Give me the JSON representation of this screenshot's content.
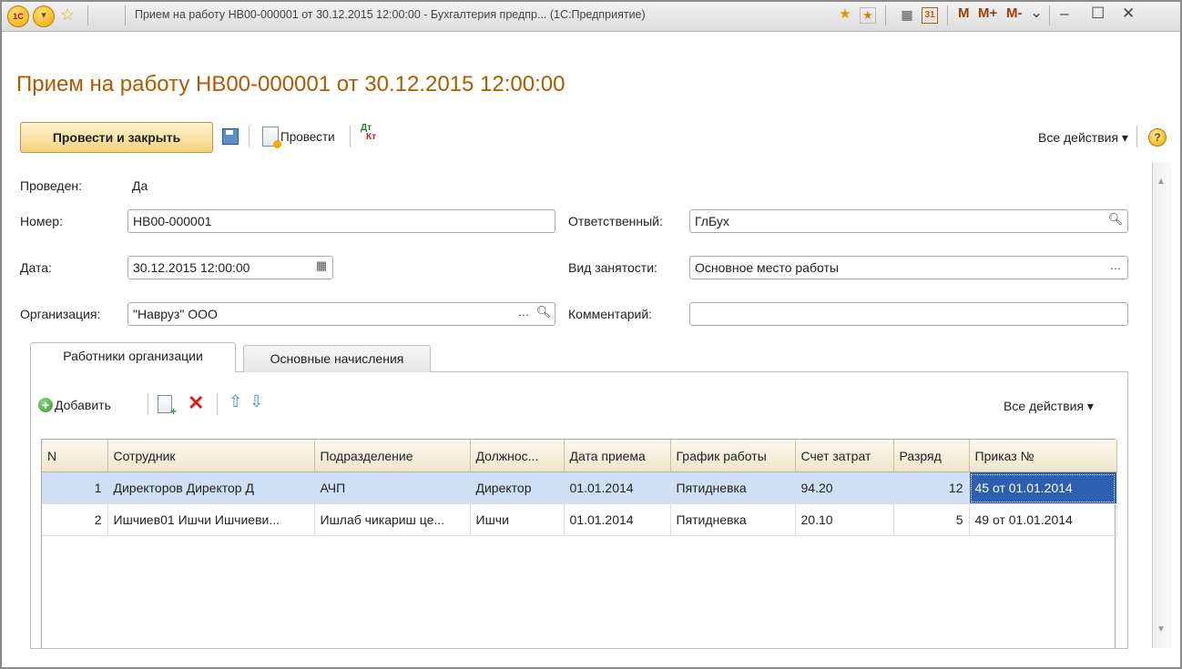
{
  "window": {
    "title": "Прием на работу НВ00-000001 от 30.12.2015 12:00:00 - Бухгалтерия предпр... (1С:Предприятие)",
    "logo_text": "1С",
    "icons": [
      "app-menu-icon",
      "favorite-star-icon",
      "history-icon",
      "favorites-icon",
      "calculator-icon",
      "calendar-icon"
    ],
    "m_buttons": [
      "M",
      "M+",
      "M-"
    ],
    "calendar_text": "31"
  },
  "document": {
    "title": "Прием на работу НВ00-000001 от 30.12.2015 12:00:00"
  },
  "toolbar": {
    "post_close_label": "Провести и закрыть",
    "post_label": "Провести",
    "dt_label": "Дт",
    "kt_label": "Кт",
    "all_actions_label": "Все действия ▾",
    "help_label": "?"
  },
  "fields": {
    "posted_label": "Проведен:",
    "posted_value": "Да",
    "number_label": "Номер:",
    "number_value": "НВ00-000001",
    "date_label": "Дата:",
    "date_value": "30.12.2015 12:00:00",
    "org_label": "Организация:",
    "org_value": "\"Навруз\" ООО",
    "responsible_label": "Ответственный:",
    "responsible_value": "ГлБух",
    "employment_label": "Вид занятости:",
    "employment_value": "Основное место работы",
    "comment_label": "Комментарий:",
    "comment_value": ""
  },
  "tabs": [
    {
      "label": "Работники организации",
      "active": true
    },
    {
      "label": "Основные начисления",
      "active": false
    }
  ],
  "table_toolbar": {
    "add_label": "Добавить",
    "all_actions_label": "Все действия ▾"
  },
  "table": {
    "columns": [
      "N",
      "Сотрудник",
      "Подразделение",
      "Должнос...",
      "Дата приема",
      "График работы",
      "Счет затрат",
      "Разряд",
      "Приказ №"
    ],
    "rows": [
      [
        "1",
        "Директоров Директор Д",
        "АЧП",
        "Директор",
        "01.01.2014",
        "Пятидневка",
        "94.20",
        "12",
        "45 от 01.01.2014"
      ],
      [
        "2",
        "Ишчиев01 Ишчи Ишчиеви...",
        "Ишлаб чикариш це...",
        "Ишчи",
        "01.01.2014",
        "Пятидневка",
        "20.10",
        "5",
        "49 от 01.01.2014"
      ]
    ],
    "selected_row": 0
  },
  "colors": {
    "title": "#b05a00",
    "accent_button": "#f3d27c",
    "selection": "#cfe0f6",
    "current_cell": "#2c5fb0"
  }
}
